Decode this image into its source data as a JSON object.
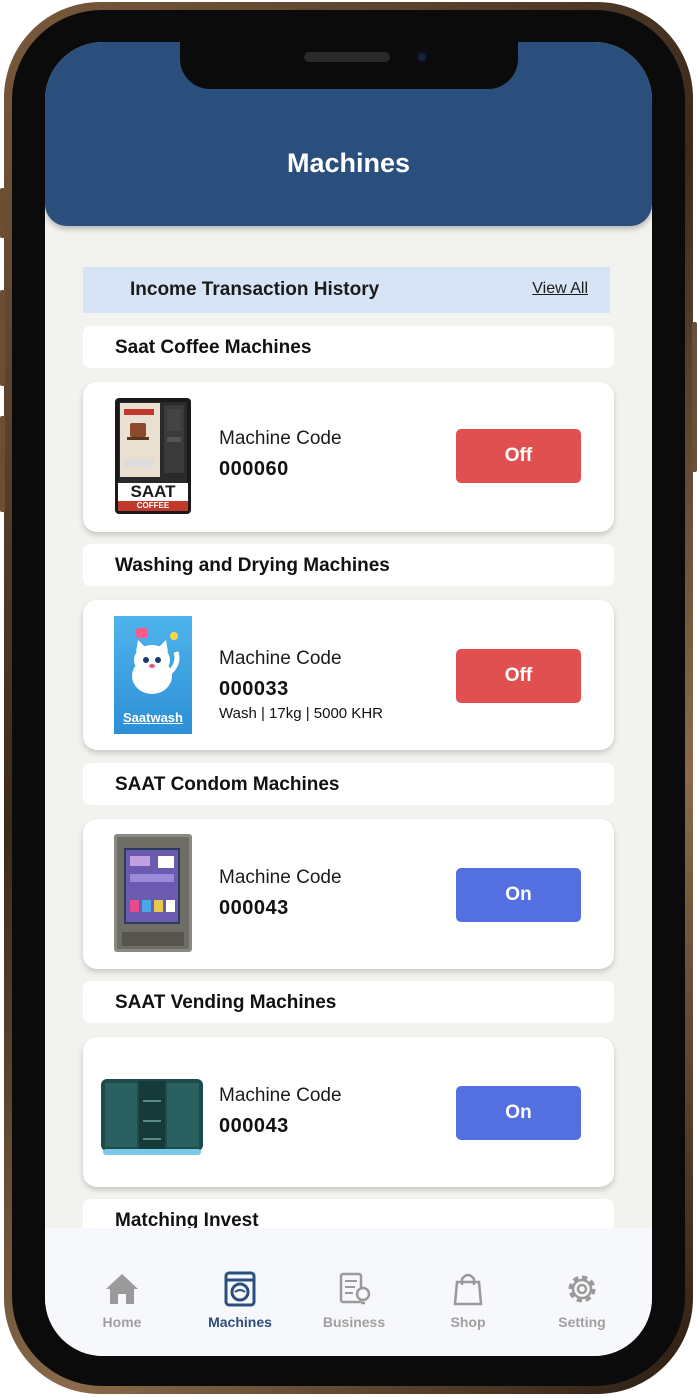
{
  "header": {
    "title": "Machines"
  },
  "history": {
    "title": "Income Transaction History",
    "view_all": "View All"
  },
  "groups": [
    {
      "section": "Saat Coffee Machines",
      "machine_label": "Machine Code",
      "code": "000060",
      "detail": "",
      "status": "Off",
      "image": "saat-coffee-machine"
    },
    {
      "section": "Washing and Drying Machines",
      "machine_label": "Machine Code",
      "code": "000033",
      "detail": "Wash | 17kg | 5000 KHR",
      "status": "Off",
      "image": "saatwash-logo",
      "image_text": "Saatwash"
    },
    {
      "section": "SAAT Condom Machines",
      "machine_label": "Machine Code",
      "code": "000043",
      "detail": "",
      "status": "On",
      "image": "condom-vending-machine"
    },
    {
      "section": "SAAT Vending Machines",
      "machine_label": "Machine Code",
      "code": "000043",
      "detail": "",
      "status": "On",
      "image": "vending-machine"
    },
    {
      "section": "Matching Invest"
    }
  ],
  "coffee_logo": {
    "brand": "SAAT",
    "sub": "COFFEE"
  },
  "nav": [
    {
      "label": "Home",
      "icon": "home-icon",
      "active": false
    },
    {
      "label": "Machines",
      "icon": "washing-machine-icon",
      "active": true
    },
    {
      "label": "Business",
      "icon": "business-report-icon",
      "active": false
    },
    {
      "label": "Shop",
      "icon": "shopping-bag-icon",
      "active": false
    },
    {
      "label": "Setting",
      "icon": "gear-icon",
      "active": false
    }
  ],
  "colors": {
    "header": "#2a4f7c",
    "off": "#e05050",
    "on": "#5470e0",
    "history_bg": "#d6e4f5",
    "nav_active": "#2a4f7c",
    "nav_inactive": "#a0a0a0"
  }
}
